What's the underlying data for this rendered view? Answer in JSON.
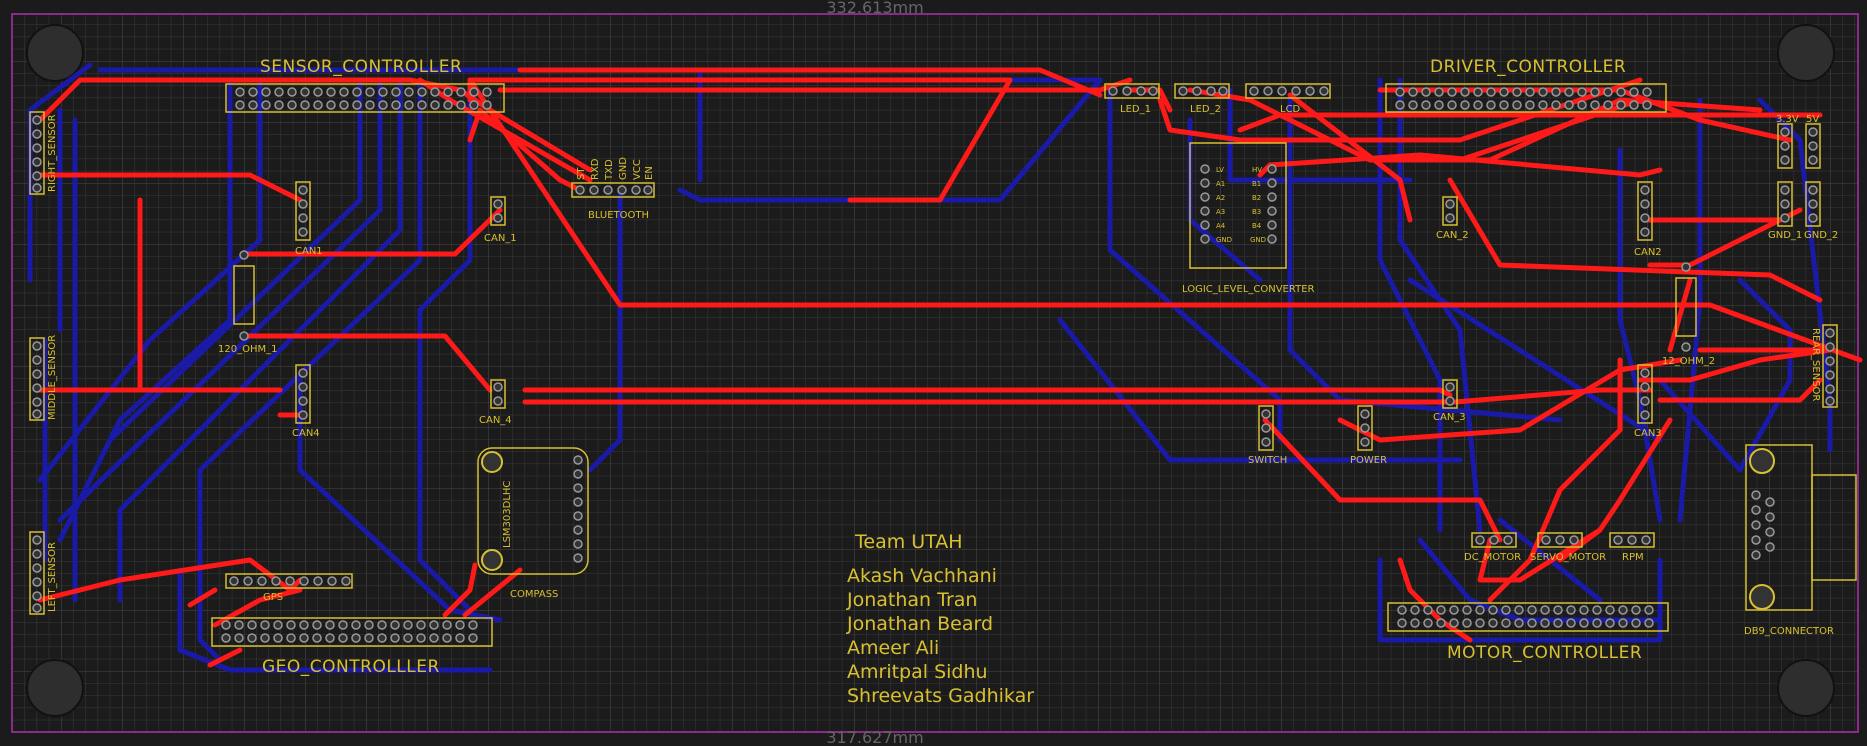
{
  "dimensions": {
    "top": "332.613mm",
    "bottom": "317.627mm"
  },
  "controllers": {
    "sensor": "SENSOR_CONTROLLER",
    "driver": "DRIVER_CONTROLLER",
    "geo": "GEO_CONTROLLLER",
    "motor": "MOTOR_CONTROLLER"
  },
  "components": {
    "can1": "CAN1",
    "can_1": "CAN_1",
    "can_2": "CAN_2",
    "can2": "CAN2",
    "can_3": "CAN_3",
    "can3": "CAN3",
    "can_4": "CAN_4",
    "can4": "CAN4",
    "ohm1": "120_OHM_1",
    "ohm2": "12_OHM_2",
    "bluetooth": "BLUETOOTH",
    "led1": "LED_1",
    "led2": "LED_2",
    "lcd": "LCD",
    "llc": "LOGIC_LEVEL_CONVERTER",
    "v33": "3.3V",
    "v5": "5V",
    "gnd1": "GND_1",
    "gnd2": "GND_2",
    "switch": "SWITCH",
    "power": "POWER",
    "dc_motor": "DC_MOTOR",
    "servo_motor": "SERVO_MOTOR",
    "rpm": "RPM",
    "db9": "DB9_CONNECTOR",
    "gps": "GPS",
    "compass": "COMPASS",
    "compass_chip": "LSM303DLHC",
    "right_sensor": "RIGHT_SENSOR",
    "middle_sensor": "MIDDLE_SENSOR",
    "left_sensor": "LEFT_SENSOR",
    "rear_sensor": "REAR_SENSOR"
  },
  "bluetooth_pins": [
    "ST",
    "RXD",
    "TXD",
    "GND",
    "VCC",
    "EN"
  ],
  "llc_pins_left": [
    "LV",
    "A1",
    "A2",
    "A3",
    "A4",
    "GND"
  ],
  "llc_pins_right": [
    "HV",
    "B1",
    "B2",
    "B3",
    "B4",
    "GND"
  ],
  "team": {
    "name": "Team UTAH",
    "members": [
      "Akash Vachhani",
      "Jonathan Tran",
      "Jonathan Beard",
      "Ameer Ali",
      "Amritpal Sidhu",
      "Shreevats Gadhikar"
    ]
  },
  "colors": {
    "background": "#1b1b1b",
    "grid": "#3a3a3a",
    "top_copper": "#ff1a1a",
    "bottom_copper": "#1a1aa8",
    "silkscreen": "#d8c030",
    "outline": "#8a2a8a"
  }
}
